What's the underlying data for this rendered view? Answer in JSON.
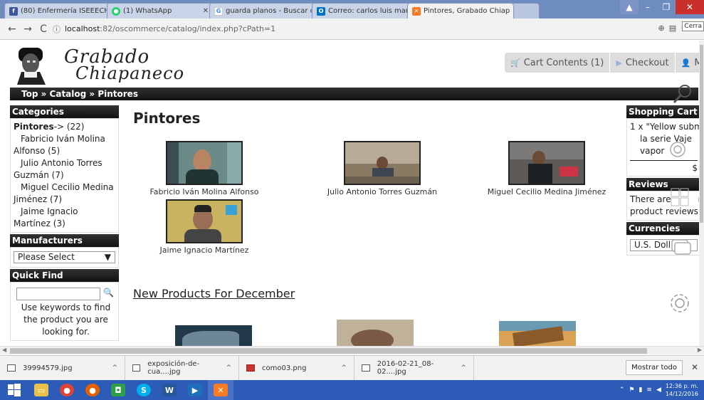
{
  "browser": {
    "tabs": [
      {
        "label": "(80) Enfermería ISEEECH",
        "icon": "facebook-icon",
        "color": "#3b5998"
      },
      {
        "label": "(1) WhatsApp",
        "icon": "whatsapp-icon",
        "color": "#25d366"
      },
      {
        "label": "guarda planos - Buscar c",
        "icon": "google-icon",
        "color": "#4285f4"
      },
      {
        "label": "Correo: carlos luis marro",
        "icon": "outlook-icon",
        "color": "#0072c6"
      },
      {
        "label": "Pintores, Grabado Chiap",
        "icon": "xampp-icon",
        "color": "#fb7a24"
      }
    ],
    "url_host": "localhost",
    "url_path": ":82/oscommerce/catalog/index.php?cPath=1",
    "tooltip": "Cerra"
  },
  "header": {
    "logo_line1": "Grabado",
    "logo_line2": "Chiapaneco",
    "cart_label": "Cart Contents (1)",
    "checkout_label": "Checkout",
    "account_label": "My A"
  },
  "breadcrumb": "Top » Catalog » Pintores",
  "sidebar_left": {
    "categories_title": "Categories",
    "top_category": "Pintores",
    "top_suffix": "-> (22)",
    "items": [
      {
        "first": "Fabricio Iván Molina",
        "second": "Alfonso (5)"
      },
      {
        "first": "Julio Antonio Torres",
        "second": "Guzmán (7)"
      },
      {
        "first": "Miguel Cecilio Medina",
        "second": "Jiménez (7)"
      },
      {
        "first": "Jaime Ignacio",
        "second": "Martínez (3)"
      }
    ],
    "manufacturers_title": "Manufacturers",
    "manufacturers_select": "Please Select",
    "quickfind_title": "Quick Find",
    "quickfind_help": "Use keywords to find the product you are looking for."
  },
  "main": {
    "title": "Pintores",
    "products": [
      {
        "name": "Fabricio Iván Molina Alfonso"
      },
      {
        "name": "Julio Antonio Torres Guzmán"
      },
      {
        "name": "Miguel Cecilio Medina Jiménez"
      },
      {
        "name": "Jaime Ignacio Martínez"
      }
    ],
    "new_products_title": "New Products For December"
  },
  "sidebar_right": {
    "cart_title": "Shopping Cart",
    "cart_line1": "1 x \"Yellow subm",
    "cart_line2": "la serie Vaje",
    "cart_line3": "vapor",
    "cart_total": "$",
    "reviews_title": "Reviews",
    "reviews_line1": "There are",
    "reviews_line1b": "n",
    "reviews_line2": "product reviews",
    "currencies_title": "Currencies",
    "currency_value": "U.S. Doll"
  },
  "downloads": {
    "items": [
      {
        "name": "39994579.jpg"
      },
      {
        "name": "exposición-de-cua....jpg"
      },
      {
        "name": "como03.png"
      },
      {
        "name": "2016-02-21_08-02....jpg"
      }
    ],
    "show_all": "Mostrar todo"
  },
  "taskbar": {
    "time": "12:36 p. m.",
    "date": "14/12/2016"
  }
}
